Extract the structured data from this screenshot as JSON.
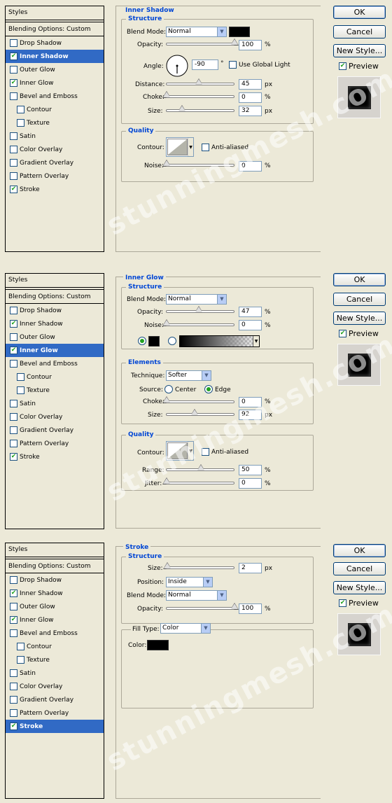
{
  "panels": [
    {
      "styles_header": "Styles",
      "blending": "Blending Options: Custom",
      "items": [
        {
          "label": "Drop Shadow",
          "checked": false,
          "sub": false,
          "sel": false
        },
        {
          "label": "Inner Shadow",
          "checked": true,
          "sub": false,
          "sel": true
        },
        {
          "label": "Outer Glow",
          "checked": false,
          "sub": false,
          "sel": false
        },
        {
          "label": "Inner Glow",
          "checked": true,
          "sub": false,
          "sel": false
        },
        {
          "label": "Bevel and Emboss",
          "checked": false,
          "sub": false,
          "sel": false
        },
        {
          "label": "Contour",
          "checked": false,
          "sub": true,
          "sel": false
        },
        {
          "label": "Texture",
          "checked": false,
          "sub": true,
          "sel": false
        },
        {
          "label": "Satin",
          "checked": false,
          "sub": false,
          "sel": false
        },
        {
          "label": "Color Overlay",
          "checked": false,
          "sub": false,
          "sel": false
        },
        {
          "label": "Gradient Overlay",
          "checked": false,
          "sub": false,
          "sel": false
        },
        {
          "label": "Pattern Overlay",
          "checked": false,
          "sub": false,
          "sel": false
        },
        {
          "label": "Stroke",
          "checked": true,
          "sub": false,
          "sel": false
        }
      ],
      "title": "Inner Shadow",
      "structure": "Structure",
      "blend_mode_label": "Blend Mode:",
      "blend_mode": "Normal",
      "opacity_label": "Opacity:",
      "opacity": "100",
      "angle_label": "Angle:",
      "angle": "-90",
      "angle_unit": "°",
      "global_light": "Use Global Light",
      "distance_label": "Distance:",
      "distance": "45",
      "choke_label": "Choke:",
      "choke": "0",
      "size_label": "Size:",
      "size": "32",
      "quality": "Quality",
      "contour_label": "Contour:",
      "anti_aliased": "Anti-aliased",
      "noise_label": "Noise:",
      "noise": "0",
      "pct": "%",
      "px": "px"
    },
    {
      "styles_header": "Styles",
      "blending": "Blending Options: Custom",
      "items": [
        {
          "label": "Drop Shadow",
          "checked": false,
          "sub": false,
          "sel": false
        },
        {
          "label": "Inner Shadow",
          "checked": true,
          "sub": false,
          "sel": false
        },
        {
          "label": "Outer Glow",
          "checked": false,
          "sub": false,
          "sel": false
        },
        {
          "label": "Inner Glow",
          "checked": true,
          "sub": false,
          "sel": true
        },
        {
          "label": "Bevel and Emboss",
          "checked": false,
          "sub": false,
          "sel": false
        },
        {
          "label": "Contour",
          "checked": false,
          "sub": true,
          "sel": false
        },
        {
          "label": "Texture",
          "checked": false,
          "sub": true,
          "sel": false
        },
        {
          "label": "Satin",
          "checked": false,
          "sub": false,
          "sel": false
        },
        {
          "label": "Color Overlay",
          "checked": false,
          "sub": false,
          "sel": false
        },
        {
          "label": "Gradient Overlay",
          "checked": false,
          "sub": false,
          "sel": false
        },
        {
          "label": "Pattern Overlay",
          "checked": false,
          "sub": false,
          "sel": false
        },
        {
          "label": "Stroke",
          "checked": true,
          "sub": false,
          "sel": false
        }
      ],
      "title": "Inner Glow",
      "structure": "Structure",
      "blend_mode_label": "Blend Mode:",
      "blend_mode": "Normal",
      "opacity_label": "Opacity:",
      "opacity": "47",
      "noise_label": "Noise:",
      "noise": "0",
      "elements": "Elements",
      "technique_label": "Technique:",
      "technique": "Softer",
      "source_label": "Source:",
      "center": "Center",
      "edge": "Edge",
      "choke_label": "Choke:",
      "choke": "0",
      "size_label": "Size:",
      "size": "92",
      "quality": "Quality",
      "contour_label": "Contour:",
      "anti_aliased": "Anti-aliased",
      "range_label": "Range:",
      "range": "50",
      "jitter_label": "Jitter:",
      "jitter": "0",
      "pct": "%",
      "px": "px"
    },
    {
      "styles_header": "Styles",
      "blending": "Blending Options: Custom",
      "items": [
        {
          "label": "Drop Shadow",
          "checked": false,
          "sub": false,
          "sel": false
        },
        {
          "label": "Inner Shadow",
          "checked": true,
          "sub": false,
          "sel": false
        },
        {
          "label": "Outer Glow",
          "checked": false,
          "sub": false,
          "sel": false
        },
        {
          "label": "Inner Glow",
          "checked": true,
          "sub": false,
          "sel": false
        },
        {
          "label": "Bevel and Emboss",
          "checked": false,
          "sub": false,
          "sel": false
        },
        {
          "label": "Contour",
          "checked": false,
          "sub": true,
          "sel": false
        },
        {
          "label": "Texture",
          "checked": false,
          "sub": true,
          "sel": false
        },
        {
          "label": "Satin",
          "checked": false,
          "sub": false,
          "sel": false
        },
        {
          "label": "Color Overlay",
          "checked": false,
          "sub": false,
          "sel": false
        },
        {
          "label": "Gradient Overlay",
          "checked": false,
          "sub": false,
          "sel": false
        },
        {
          "label": "Pattern Overlay",
          "checked": false,
          "sub": false,
          "sel": false
        },
        {
          "label": "Stroke",
          "checked": true,
          "sub": false,
          "sel": true
        }
      ],
      "title": "Stroke",
      "structure": "Structure",
      "size_label": "Size:",
      "size": "2",
      "position_label": "Position:",
      "position": "Inside",
      "blend_mode_label": "Blend Mode:",
      "blend_mode": "Normal",
      "opacity_label": "Opacity:",
      "opacity": "100",
      "fill_type_label": "Fill Type:",
      "fill_type": "Color",
      "color_label": "Color:",
      "pct": "%",
      "px": "px"
    }
  ],
  "buttons": {
    "ok": "OK",
    "cancel": "Cancel",
    "new_style": "New Style...",
    "preview": "Preview"
  },
  "watermark": "stunningmesh.com",
  "colors": {
    "accent": "#0046d5",
    "selection": "#316ac5",
    "swatch": "#000000"
  }
}
